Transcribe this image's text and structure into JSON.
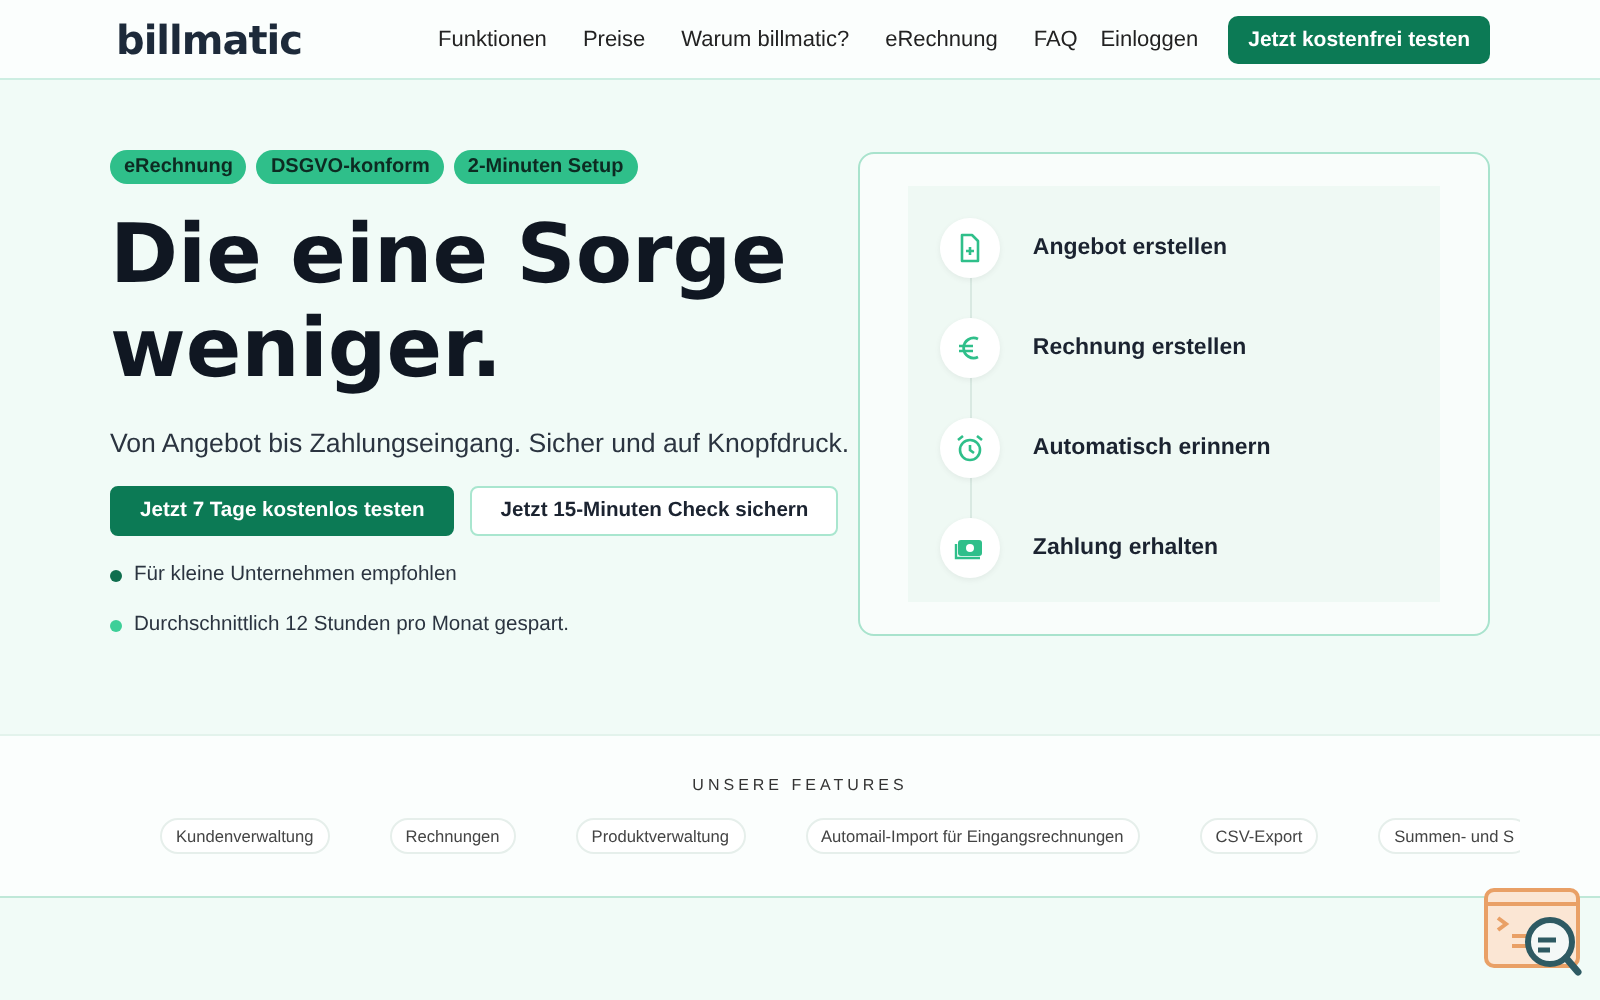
{
  "header": {
    "logo": "billmatic",
    "nav": [
      "Funktionen",
      "Preise",
      "Warum billmatic?",
      "eRechnung",
      "FAQ"
    ],
    "login": "Einloggen",
    "cta": "Jetzt kostenfrei testen"
  },
  "hero": {
    "badges": [
      "eRechnung",
      "DSGVO-konform",
      "2-Minuten Setup"
    ],
    "headline": [
      "Die eine Sorge",
      "weniger."
    ],
    "subtitle": "Von Angebot bis Zahlungseingang. Sicher und auf Knopfdruck.",
    "buttons": [
      {
        "kind": "primary",
        "label": "Jetzt 7 Tage kostenlos testen"
      },
      {
        "kind": "secondary",
        "label": "Jetzt 15-Minuten Check sichern"
      }
    ],
    "bullets": [
      {
        "text": "Für kleine Unternehmen empfohlen",
        "color": "#0f6e4e"
      },
      {
        "text": "Durchschnittlich 12 Stunden pro Monat gespart.",
        "color": "#3ecf98"
      }
    ]
  },
  "steps": [
    {
      "kind": "document",
      "label": "Angebot erstellen"
    },
    {
      "kind": "euro",
      "label": "Rechnung erstellen"
    },
    {
      "kind": "alarm",
      "label": "Automatisch erinnern"
    },
    {
      "kind": "money",
      "label": "Zahlung erhalten"
    }
  ],
  "features": {
    "title": "UNSERE FEATURES",
    "items": [
      "Kundenverwaltung",
      "Rechnungen",
      "Produktverwaltung",
      "Automail-Import für Eingangsrechnungen",
      "CSV-Export",
      "Summen- und S"
    ]
  }
}
